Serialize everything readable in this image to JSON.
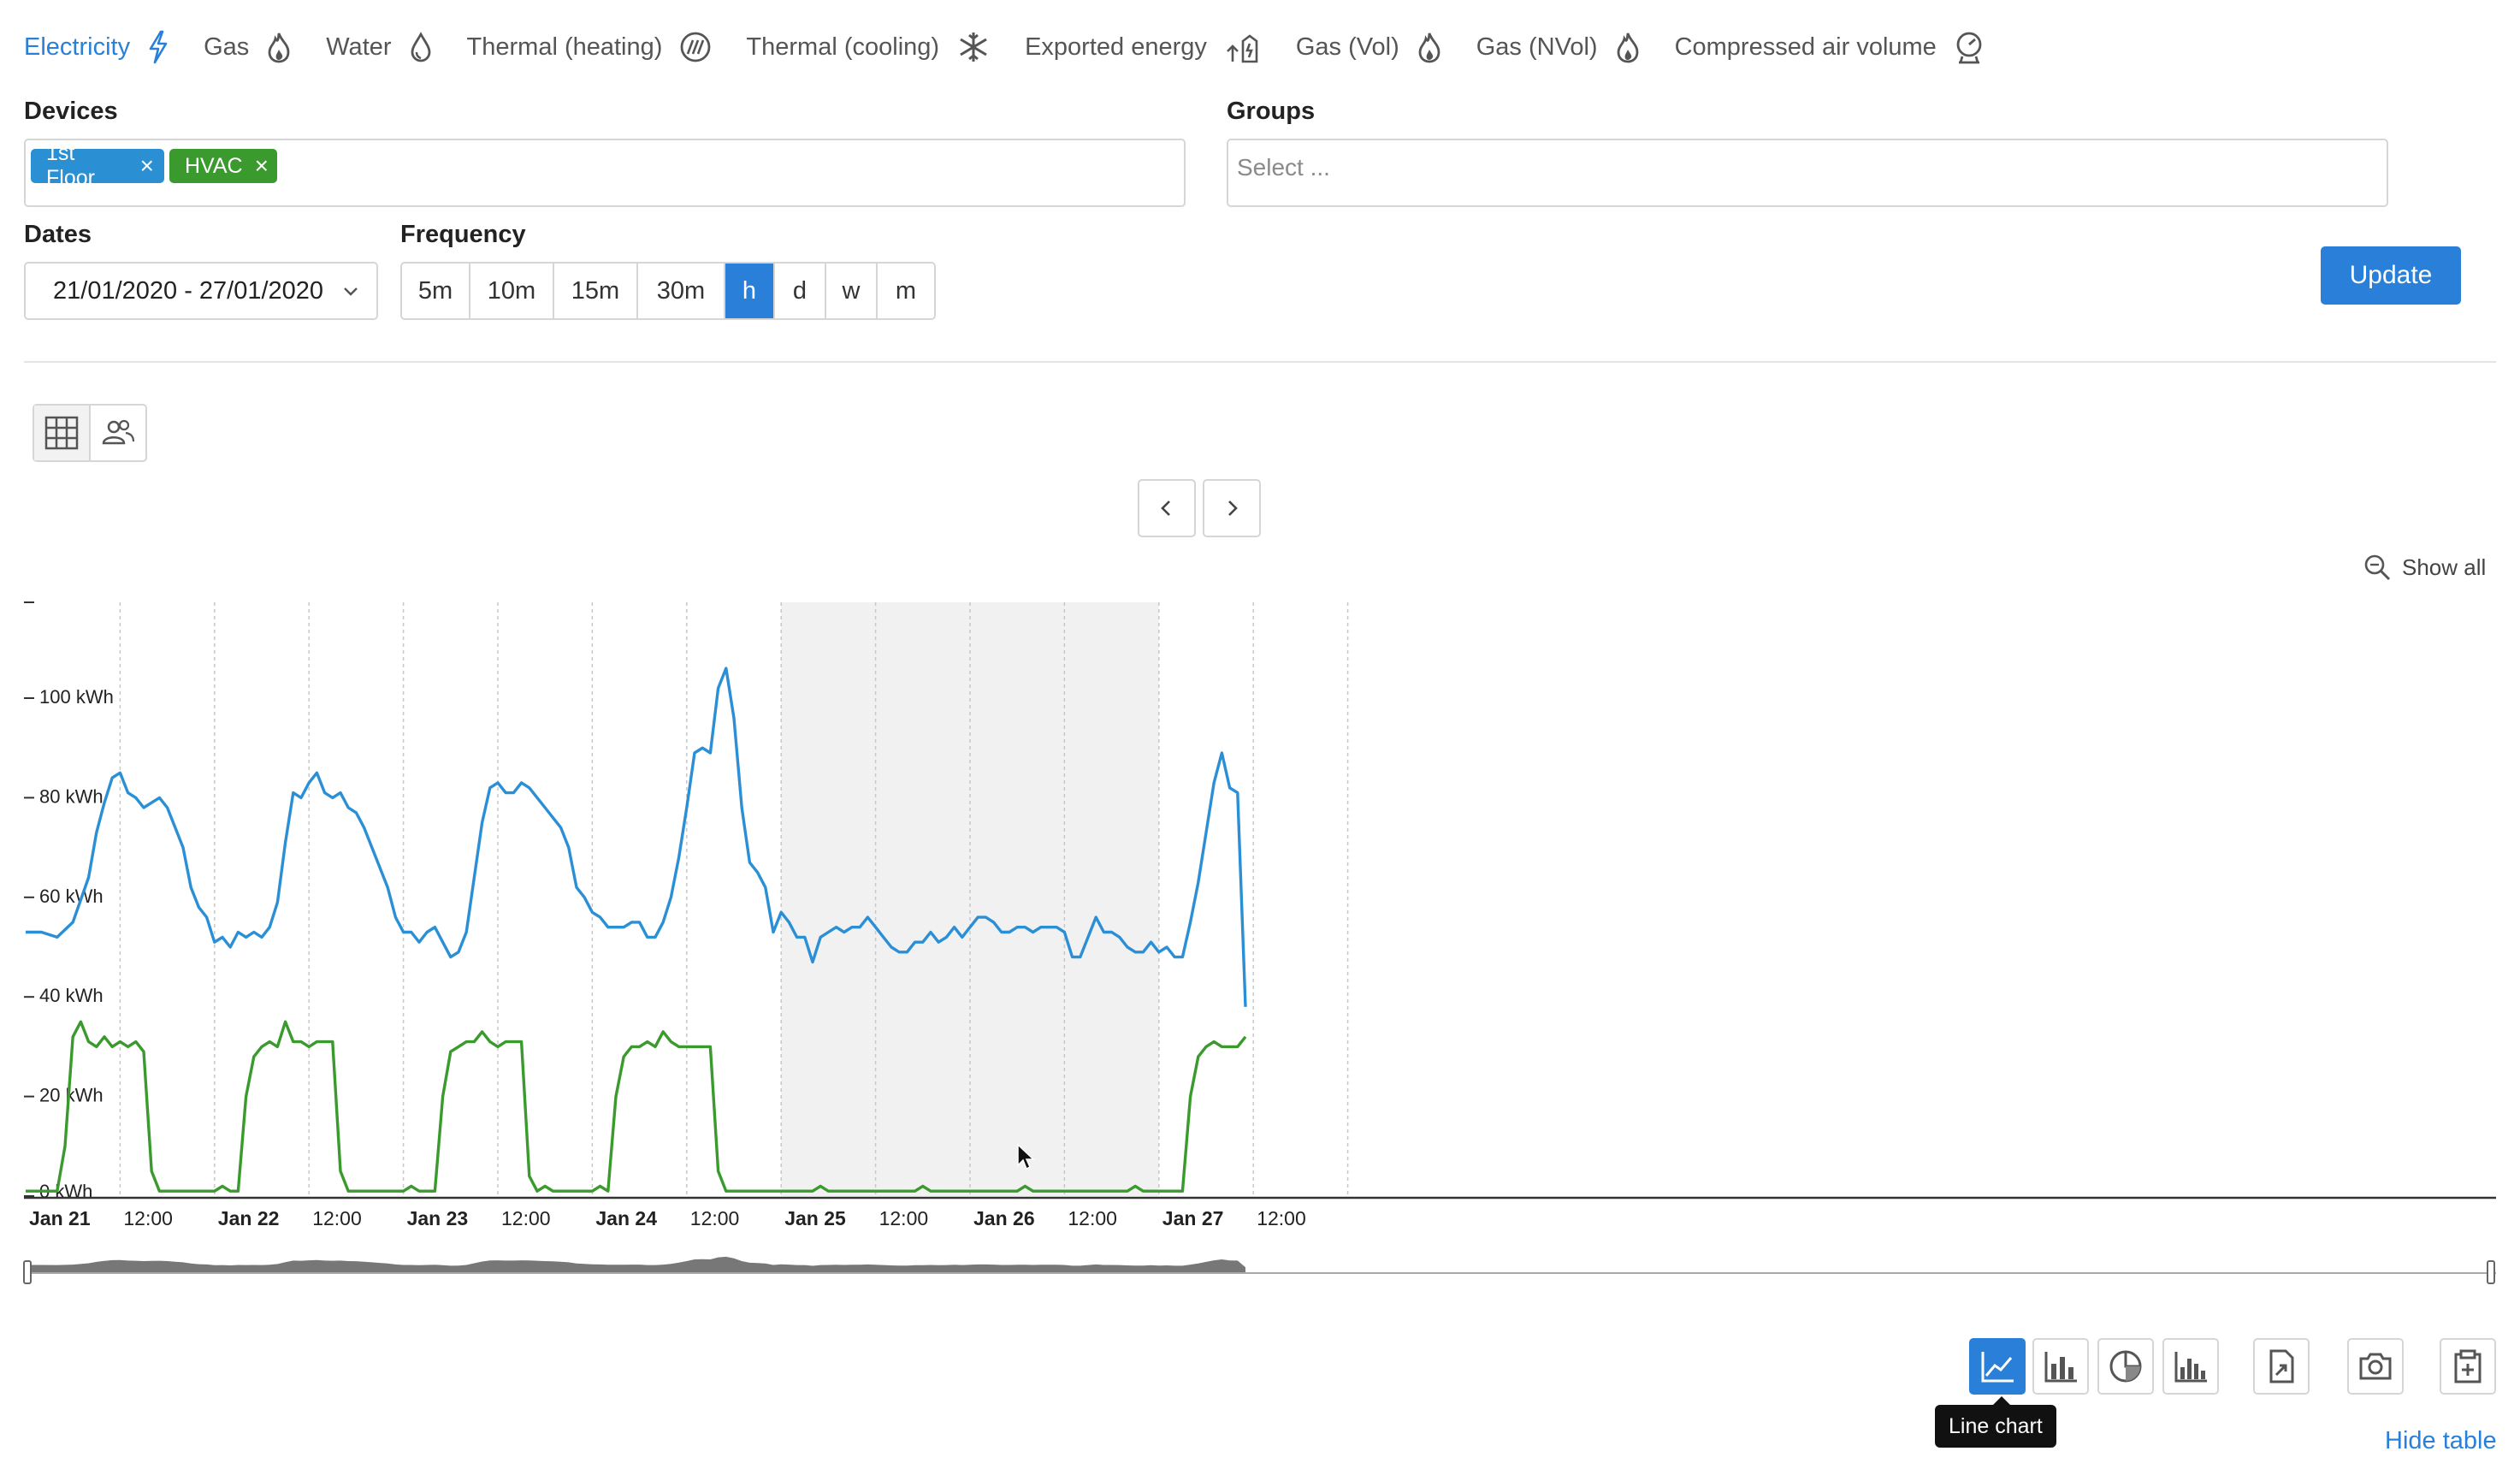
{
  "tabs": [
    {
      "label": "Electricity",
      "icon": "lightning-icon",
      "active": true
    },
    {
      "label": "Gas",
      "icon": "flame-icon"
    },
    {
      "label": "Water",
      "icon": "drop-icon"
    },
    {
      "label": "Thermal (heating)",
      "icon": "heating-icon"
    },
    {
      "label": "Thermal (cooling)",
      "icon": "snowflake-icon"
    },
    {
      "label": "Exported energy",
      "icon": "export-energy-icon"
    },
    {
      "label": "Gas (Vol)",
      "icon": "flame-icon"
    },
    {
      "label": "Gas (NVol)",
      "icon": "flame-icon"
    },
    {
      "label": "Compressed air volume",
      "icon": "gauge-icon"
    }
  ],
  "devices": {
    "label": "Devices",
    "chips": [
      {
        "text": "1st Floor",
        "color": "#2a8fd3"
      },
      {
        "text": "HVAC",
        "color": "#3a9a2e"
      }
    ]
  },
  "groups": {
    "label": "Groups",
    "placeholder": "Select ..."
  },
  "dates": {
    "label": "Dates",
    "value": "21/01/2020 - 27/01/2020"
  },
  "frequency": {
    "label": "Frequency",
    "options": [
      "5m",
      "10m",
      "15m",
      "30m",
      "h",
      "d",
      "w",
      "m"
    ],
    "selected": "h"
  },
  "update_label": "Update",
  "show_all_label": "Show all",
  "toolbar": {
    "tooltip": "Line chart",
    "hide_table": "Hide table"
  },
  "chart_data": {
    "type": "line",
    "y_tick_labels": [
      "0 kWh",
      "20 kWh",
      "40 kWh",
      "60 kWh",
      "80 kWh",
      "100 kWh"
    ],
    "ylim": [
      0,
      120
    ],
    "x_tick_labels": [
      "Jan 21",
      "12:00",
      "Jan 22",
      "12:00",
      "Jan 23",
      "12:00",
      "Jan 24",
      "12:00",
      "Jan 25",
      "12:00",
      "Jan 26",
      "12:00",
      "Jan 27",
      "12:00"
    ],
    "x_unit": "hours since Jan 21 00:00",
    "shaded_range": [
      96,
      144
    ],
    "series": [
      {
        "color": "#2b8fd6",
        "points": [
          [
            0,
            53
          ],
          [
            2,
            53
          ],
          [
            4,
            52
          ],
          [
            6,
            55
          ],
          [
            8,
            64
          ],
          [
            9,
            73
          ],
          [
            10,
            79
          ],
          [
            11,
            84
          ],
          [
            12,
            85
          ],
          [
            13,
            81
          ],
          [
            14,
            80
          ],
          [
            15,
            78
          ],
          [
            16,
            79
          ],
          [
            17,
            80
          ],
          [
            18,
            78
          ],
          [
            19,
            74
          ],
          [
            20,
            70
          ],
          [
            21,
            62
          ],
          [
            22,
            58
          ],
          [
            23,
            56
          ],
          [
            24,
            51
          ],
          [
            25,
            52
          ],
          [
            26,
            50
          ],
          [
            27,
            53
          ],
          [
            28,
            52
          ],
          [
            29,
            53
          ],
          [
            30,
            52
          ],
          [
            31,
            54
          ],
          [
            32,
            59
          ],
          [
            33,
            71
          ],
          [
            34,
            81
          ],
          [
            35,
            80
          ],
          [
            36,
            83
          ],
          [
            37,
            85
          ],
          [
            38,
            81
          ],
          [
            39,
            80
          ],
          [
            40,
            81
          ],
          [
            41,
            78
          ],
          [
            42,
            77
          ],
          [
            43,
            74
          ],
          [
            44,
            70
          ],
          [
            45,
            66
          ],
          [
            46,
            62
          ],
          [
            47,
            56
          ],
          [
            48,
            53
          ],
          [
            49,
            53
          ],
          [
            50,
            51
          ],
          [
            51,
            53
          ],
          [
            52,
            54
          ],
          [
            53,
            51
          ],
          [
            54,
            48
          ],
          [
            55,
            49
          ],
          [
            56,
            53
          ],
          [
            57,
            64
          ],
          [
            58,
            75
          ],
          [
            59,
            82
          ],
          [
            60,
            83
          ],
          [
            61,
            81
          ],
          [
            62,
            81
          ],
          [
            63,
            83
          ],
          [
            64,
            82
          ],
          [
            65,
            80
          ],
          [
            66,
            78
          ],
          [
            67,
            76
          ],
          [
            68,
            74
          ],
          [
            69,
            70
          ],
          [
            70,
            62
          ],
          [
            71,
            60
          ],
          [
            72,
            57
          ],
          [
            73,
            56
          ],
          [
            74,
            54
          ],
          [
            75,
            54
          ],
          [
            76,
            54
          ],
          [
            77,
            55
          ],
          [
            78,
            55
          ],
          [
            79,
            52
          ],
          [
            80,
            52
          ],
          [
            81,
            55
          ],
          [
            82,
            60
          ],
          [
            83,
            68
          ],
          [
            84,
            78
          ],
          [
            85,
            89
          ],
          [
            86,
            90
          ],
          [
            87,
            89
          ],
          [
            88,
            102
          ],
          [
            89,
            106
          ],
          [
            90,
            96
          ],
          [
            91,
            78
          ],
          [
            92,
            67
          ],
          [
            93,
            65
          ],
          [
            94,
            62
          ],
          [
            95,
            53
          ],
          [
            96,
            57
          ],
          [
            97,
            55
          ],
          [
            98,
            52
          ],
          [
            99,
            52
          ],
          [
            100,
            47
          ],
          [
            101,
            52
          ],
          [
            102,
            53
          ],
          [
            103,
            54
          ],
          [
            104,
            53
          ],
          [
            105,
            54
          ],
          [
            106,
            54
          ],
          [
            107,
            56
          ],
          [
            108,
            54
          ],
          [
            109,
            52
          ],
          [
            110,
            50
          ],
          [
            111,
            49
          ],
          [
            112,
            49
          ],
          [
            113,
            51
          ],
          [
            114,
            51
          ],
          [
            115,
            53
          ],
          [
            116,
            51
          ],
          [
            117,
            52
          ],
          [
            118,
            54
          ],
          [
            119,
            52
          ],
          [
            120,
            54
          ],
          [
            121,
            56
          ],
          [
            122,
            56
          ],
          [
            123,
            55
          ],
          [
            124,
            53
          ],
          [
            125,
            53
          ],
          [
            126,
            54
          ],
          [
            127,
            54
          ],
          [
            128,
            53
          ],
          [
            129,
            54
          ],
          [
            130,
            54
          ],
          [
            131,
            54
          ],
          [
            132,
            53
          ],
          [
            133,
            48
          ],
          [
            134,
            48
          ],
          [
            135,
            52
          ],
          [
            136,
            56
          ],
          [
            137,
            53
          ],
          [
            138,
            53
          ],
          [
            139,
            52
          ],
          [
            140,
            50
          ],
          [
            141,
            49
          ],
          [
            142,
            49
          ],
          [
            143,
            51
          ],
          [
            144,
            49
          ],
          [
            145,
            50
          ],
          [
            146,
            48
          ],
          [
            147,
            48
          ],
          [
            148,
            55
          ],
          [
            149,
            63
          ],
          [
            150,
            73
          ],
          [
            151,
            83
          ],
          [
            152,
            89
          ],
          [
            153,
            82
          ],
          [
            154,
            81
          ],
          [
            155,
            38
          ]
        ]
      },
      {
        "color": "#3a9a2e",
        "points": [
          [
            0,
            1
          ],
          [
            4,
            1
          ],
          [
            5,
            10
          ],
          [
            6,
            32
          ],
          [
            7,
            35
          ],
          [
            8,
            31
          ],
          [
            9,
            30
          ],
          [
            10,
            32
          ],
          [
            11,
            30
          ],
          [
            12,
            31
          ],
          [
            13,
            30
          ],
          [
            14,
            31
          ],
          [
            15,
            29
          ],
          [
            16,
            5
          ],
          [
            17,
            1
          ],
          [
            24,
            1
          ],
          [
            25,
            2
          ],
          [
            26,
            1
          ],
          [
            27,
            1
          ],
          [
            28,
            20
          ],
          [
            29,
            28
          ],
          [
            30,
            30
          ],
          [
            31,
            31
          ],
          [
            32,
            30
          ],
          [
            33,
            35
          ],
          [
            34,
            31
          ],
          [
            35,
            31
          ],
          [
            36,
            30
          ],
          [
            37,
            31
          ],
          [
            38,
            31
          ],
          [
            39,
            31
          ],
          [
            40,
            5
          ],
          [
            41,
            1
          ],
          [
            48,
            1
          ],
          [
            49,
            2
          ],
          [
            50,
            1
          ],
          [
            52,
            1
          ],
          [
            53,
            20
          ],
          [
            54,
            29
          ],
          [
            55,
            30
          ],
          [
            56,
            31
          ],
          [
            57,
            31
          ],
          [
            58,
            33
          ],
          [
            59,
            31
          ],
          [
            60,
            30
          ],
          [
            61,
            31
          ],
          [
            62,
            31
          ],
          [
            63,
            31
          ],
          [
            64,
            4
          ],
          [
            65,
            1
          ],
          [
            66,
            2
          ],
          [
            67,
            1
          ],
          [
            72,
            1
          ],
          [
            73,
            2
          ],
          [
            74,
            1
          ],
          [
            75,
            20
          ],
          [
            76,
            28
          ],
          [
            77,
            30
          ],
          [
            78,
            30
          ],
          [
            79,
            31
          ],
          [
            80,
            30
          ],
          [
            81,
            33
          ],
          [
            82,
            31
          ],
          [
            83,
            30
          ],
          [
            84,
            30
          ],
          [
            85,
            30
          ],
          [
            86,
            30
          ],
          [
            87,
            30
          ],
          [
            88,
            5
          ],
          [
            89,
            1
          ],
          [
            100,
            1
          ],
          [
            101,
            2
          ],
          [
            102,
            1
          ],
          [
            113,
            1
          ],
          [
            114,
            2
          ],
          [
            115,
            1
          ],
          [
            126,
            1
          ],
          [
            127,
            2
          ],
          [
            128,
            1
          ],
          [
            140,
            1
          ],
          [
            141,
            2
          ],
          [
            142,
            1
          ],
          [
            147,
            1
          ],
          [
            148,
            20
          ],
          [
            149,
            28
          ],
          [
            150,
            30
          ],
          [
            151,
            31
          ],
          [
            152,
            30
          ],
          [
            153,
            30
          ],
          [
            154,
            30
          ],
          [
            155,
            32
          ]
        ]
      }
    ]
  }
}
